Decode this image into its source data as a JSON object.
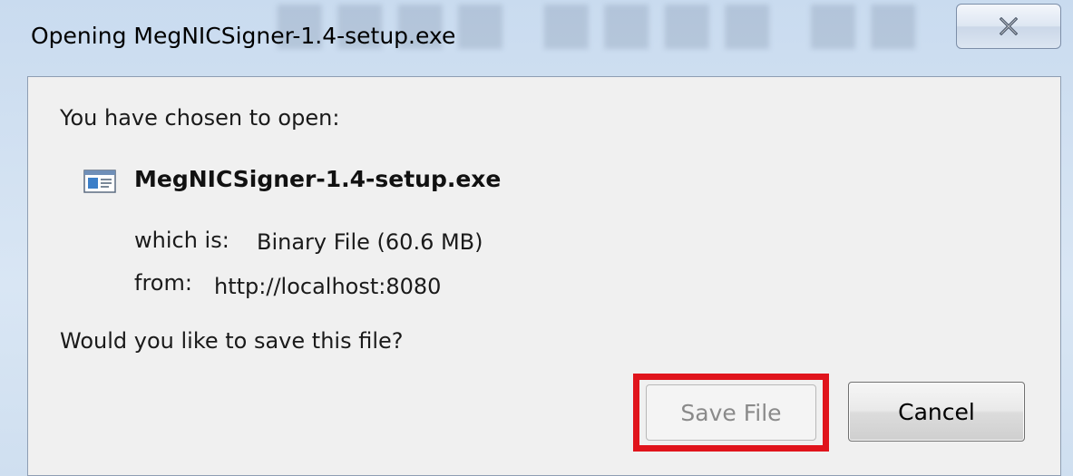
{
  "window": {
    "title": "Opening MegNICSigner-1.4-setup.exe",
    "close_icon": "close-icon"
  },
  "dialog": {
    "prompt": "You have chosen to open:",
    "file": {
      "icon": "file-icon",
      "name": "MegNICSigner-1.4-setup.exe"
    },
    "which_is_label": "which is:",
    "which_is_value": "Binary File (60.6 MB)",
    "from_label": "from:",
    "from_value": "http://localhost:8080",
    "question": "Would you like to save this file?"
  },
  "buttons": {
    "save_label": "Save File",
    "save_enabled": false,
    "cancel_label": "Cancel"
  },
  "colors": {
    "highlight": "#e0141c",
    "client_bg": "#f0f0f0",
    "frame": "#c9dbef"
  }
}
